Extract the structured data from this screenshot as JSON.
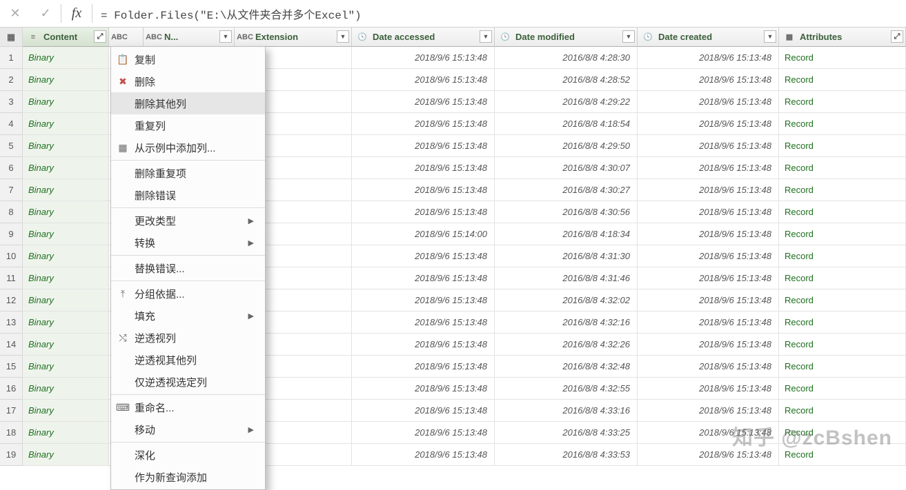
{
  "formula_bar": {
    "cancel_glyph": "✕",
    "confirm_glyph": "✓",
    "fx_glyph": "fx",
    "value": "= Folder.Files(\"E:\\从文件夹合并多个Excel\")"
  },
  "columns": {
    "content": {
      "label": "Content"
    },
    "name": {
      "label": "N..."
    },
    "extension": {
      "label": "Extension"
    },
    "accessed": {
      "label": "Date accessed"
    },
    "modified": {
      "label": "Date modified"
    },
    "created": {
      "label": "Date created"
    },
    "attributes": {
      "label": "Attributes"
    }
  },
  "rows": [
    {
      "n": "1",
      "content": "Binary",
      "accessed": "2018/9/6 15:13:48",
      "modified": "2016/8/8 4:28:30",
      "created": "2018/9/6 15:13:48",
      "attr": "Record"
    },
    {
      "n": "2",
      "content": "Binary",
      "accessed": "2018/9/6 15:13:48",
      "modified": "2016/8/8 4:28:52",
      "created": "2018/9/6 15:13:48",
      "attr": "Record"
    },
    {
      "n": "3",
      "content": "Binary",
      "accessed": "2018/9/6 15:13:48",
      "modified": "2016/8/8 4:29:22",
      "created": "2018/9/6 15:13:48",
      "attr": "Record"
    },
    {
      "n": "4",
      "content": "Binary",
      "accessed": "2018/9/6 15:13:48",
      "modified": "2016/8/8 4:18:54",
      "created": "2018/9/6 15:13:48",
      "attr": "Record"
    },
    {
      "n": "5",
      "content": "Binary",
      "accessed": "2018/9/6 15:13:48",
      "modified": "2016/8/8 4:29:50",
      "created": "2018/9/6 15:13:48",
      "attr": "Record"
    },
    {
      "n": "6",
      "content": "Binary",
      "accessed": "2018/9/6 15:13:48",
      "modified": "2016/8/8 4:30:07",
      "created": "2018/9/6 15:13:48",
      "attr": "Record"
    },
    {
      "n": "7",
      "content": "Binary",
      "accessed": "2018/9/6 15:13:48",
      "modified": "2016/8/8 4:30:27",
      "created": "2018/9/6 15:13:48",
      "attr": "Record"
    },
    {
      "n": "8",
      "content": "Binary",
      "accessed": "2018/9/6 15:13:48",
      "modified": "2016/8/8 4:30:56",
      "created": "2018/9/6 15:13:48",
      "attr": "Record"
    },
    {
      "n": "9",
      "content": "Binary",
      "accessed": "2018/9/6 15:14:00",
      "modified": "2016/8/8 4:18:34",
      "created": "2018/9/6 15:13:48",
      "attr": "Record"
    },
    {
      "n": "10",
      "content": "Binary",
      "accessed": "2018/9/6 15:13:48",
      "modified": "2016/8/8 4:31:30",
      "created": "2018/9/6 15:13:48",
      "attr": "Record"
    },
    {
      "n": "11",
      "content": "Binary",
      "accessed": "2018/9/6 15:13:48",
      "modified": "2016/8/8 4:31:46",
      "created": "2018/9/6 15:13:48",
      "attr": "Record"
    },
    {
      "n": "12",
      "content": "Binary",
      "accessed": "2018/9/6 15:13:48",
      "modified": "2016/8/8 4:32:02",
      "created": "2018/9/6 15:13:48",
      "attr": "Record"
    },
    {
      "n": "13",
      "content": "Binary",
      "accessed": "2018/9/6 15:13:48",
      "modified": "2016/8/8 4:32:16",
      "created": "2018/9/6 15:13:48",
      "attr": "Record"
    },
    {
      "n": "14",
      "content": "Binary",
      "accessed": "2018/9/6 15:13:48",
      "modified": "2016/8/8 4:32:26",
      "created": "2018/9/6 15:13:48",
      "attr": "Record"
    },
    {
      "n": "15",
      "content": "Binary",
      "accessed": "2018/9/6 15:13:48",
      "modified": "2016/8/8 4:32:48",
      "created": "2018/9/6 15:13:48",
      "attr": "Record"
    },
    {
      "n": "16",
      "content": "Binary",
      "accessed": "2018/9/6 15:13:48",
      "modified": "2016/8/8 4:32:55",
      "created": "2018/9/6 15:13:48",
      "attr": "Record"
    },
    {
      "n": "17",
      "content": "Binary",
      "accessed": "2018/9/6 15:13:48",
      "modified": "2016/8/8 4:33:16",
      "created": "2018/9/6 15:13:48",
      "attr": "Record"
    },
    {
      "n": "18",
      "content": "Binary",
      "accessed": "2018/9/6 15:13:48",
      "modified": "2016/8/8 4:33:25",
      "created": "2018/9/6 15:13:48",
      "attr": "Record"
    },
    {
      "n": "19",
      "content": "Binary",
      "accessed": "2018/9/6 15:13:48",
      "modified": "2016/8/8 4:33:53",
      "created": "2018/9/6 15:13:48",
      "attr": "Record"
    }
  ],
  "context_menu": {
    "items": [
      {
        "icon": "📋",
        "label": "复制",
        "sep": false
      },
      {
        "icon": "✖",
        "label": "删除",
        "sep": false,
        "icon_color": "#c0504d"
      },
      {
        "icon": "",
        "label": "删除其他列",
        "sep": false,
        "highlight": true
      },
      {
        "icon": "",
        "label": "重复列",
        "sep": false
      },
      {
        "icon": "▦",
        "label": "从示例中添加列...",
        "sep": true
      },
      {
        "icon": "",
        "label": "删除重复项",
        "sep": false
      },
      {
        "icon": "",
        "label": "删除错误",
        "sep": true
      },
      {
        "icon": "",
        "label": "更改类型",
        "sep": false,
        "arrow": true
      },
      {
        "icon": "",
        "label": "转换",
        "sep": true,
        "arrow": true
      },
      {
        "icon": "",
        "label": "替换错误...",
        "sep": true
      },
      {
        "icon": "⤒",
        "label": "分组依据...",
        "sep": false
      },
      {
        "icon": "",
        "label": "填充",
        "sep": false,
        "arrow": true
      },
      {
        "icon": "⤭",
        "label": "逆透视列",
        "sep": false
      },
      {
        "icon": "",
        "label": "逆透视其他列",
        "sep": false
      },
      {
        "icon": "",
        "label": "仅逆透视选定列",
        "sep": true
      },
      {
        "icon": "⌨",
        "label": "重命名...",
        "sep": false
      },
      {
        "icon": "",
        "label": "移动",
        "sep": true,
        "arrow": true
      },
      {
        "icon": "",
        "label": "深化",
        "sep": false
      },
      {
        "icon": "",
        "label": "作为新查询添加",
        "sep": false
      }
    ]
  },
  "watermark": "知乎 @zcBshen"
}
